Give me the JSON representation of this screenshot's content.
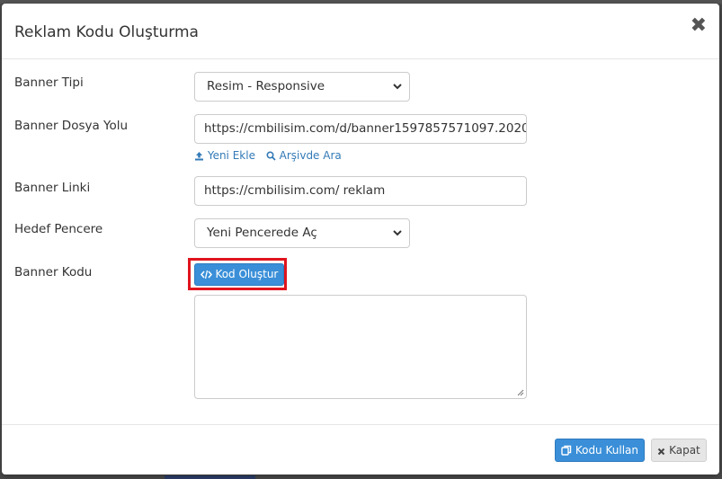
{
  "modal": {
    "title": "Reklam Kodu Oluşturma",
    "close_glyph": "✖"
  },
  "form": {
    "banner_tipi": {
      "label": "Banner Tipi",
      "selected": "Resim - Responsive"
    },
    "banner_dosya_yolu": {
      "label": "Banner Dosya Yolu",
      "value": "https://cmbilisim.com/d/banner1597857571097.2020",
      "links": {
        "yeni_ekle": "Yeni Ekle",
        "arsivde_ara": "Arşivde Ara"
      }
    },
    "banner_linki": {
      "label": "Banner Linki",
      "value": "https://cmbilisim.com/ reklam"
    },
    "hedef_pencere": {
      "label": "Hedef Pencere",
      "selected": "Yeni Pencerede Aç"
    },
    "banner_kodu": {
      "label": "Banner Kodu",
      "button_label": "Kod Oluştur",
      "code_value": ""
    }
  },
  "footer": {
    "use_code_label": "Kodu Kullan",
    "close_label": "Kapat"
  },
  "icons": {
    "upload": "upload-icon",
    "search": "search-icon",
    "code": "code-icon",
    "copy": "copy-icon",
    "close": "close-icon"
  },
  "colors": {
    "primary": "#3a8fd8",
    "link": "#337ab7",
    "highlight": "#e0141e"
  }
}
